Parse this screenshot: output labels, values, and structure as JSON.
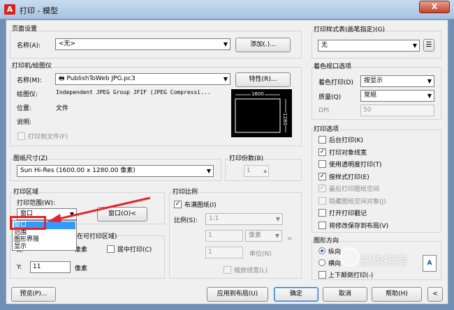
{
  "window": {
    "title": "打印 - 模型",
    "app_icon": "A",
    "close_glyph": "X"
  },
  "page_setup": {
    "group": "页面设置",
    "name_label": "名称(A):",
    "name_value": "<无>",
    "add_button": "添加(.)..."
  },
  "printer": {
    "group": "打印机/绘图仪",
    "name_label": "名称(M):",
    "name_value": "PublishToWeb JPG.pc3",
    "props_button": "特性(R)...",
    "plotter_label": "绘图仪:",
    "plotter_value": "Independent JPEG Group JFIF (JPEG Compressi...",
    "location_label": "位置:",
    "location_value": "文件",
    "desc_label": "说明:",
    "print_to_file": "打印到文件(F)",
    "preview_width": "1600",
    "preview_height": "1280"
  },
  "paper_size": {
    "group": "图纸尺寸(Z)",
    "value": "Sun Hi-Res (1600.00 x 1280.00 像素)"
  },
  "copies": {
    "label": "打印份数(B)",
    "value": "1"
  },
  "area": {
    "group": "打印区域",
    "range_label": "打印范围(W):",
    "range_value": "窗口",
    "window_button": "窗口(O)<",
    "options": [
      "窗口",
      "范围",
      "图形界限",
      "显示"
    ]
  },
  "offset": {
    "group_fragment": "在可打印区域)",
    "x_label": "X:",
    "x_unit": "像素",
    "y_label": "Y:",
    "y_value": "11",
    "y_unit": "像素",
    "center_label": "居中打印(C)"
  },
  "scale": {
    "group": "打印比例",
    "fit_label": "布满图纸(I)",
    "ratio_label": "比例(S):",
    "ratio_value": "1:1",
    "val1": "1",
    "unit1": "像素",
    "val2": "1",
    "unit2": "单位(N)",
    "eq": "=",
    "lineweights": "缩放线宽(L)"
  },
  "plot_style": {
    "group": "打印样式表(画笔指定)(G)",
    "value": "无"
  },
  "shaded": {
    "group": "着色视口选项",
    "shade_label": "着色打印(D)",
    "shade_value": "按显示",
    "quality_label": "质量(Q)",
    "quality_value": "常规",
    "dpi_label": "DPI",
    "dpi_value": "50"
  },
  "options": {
    "group": "打印选项",
    "items": [
      {
        "label": "后台打印(K)",
        "checked": false,
        "disabled": false
      },
      {
        "label": "打印对象线宽",
        "checked": true,
        "disabled": false
      },
      {
        "label": "使用透明度打印(T)",
        "checked": false,
        "disabled": false
      },
      {
        "label": "按样式打印(E)",
        "checked": true,
        "disabled": false
      },
      {
        "label": "最后打印图纸空间",
        "checked": true,
        "disabled": true
      },
      {
        "label": "隐藏图纸空间对象(J)",
        "checked": false,
        "disabled": true
      },
      {
        "label": "打开打印戳记",
        "checked": false,
        "disabled": false
      },
      {
        "label": "将修改保存到布局(V)",
        "checked": false,
        "disabled": false
      }
    ]
  },
  "orientation": {
    "group": "图形方向",
    "portrait": "纵向",
    "landscape": "横向",
    "upside": "上下颠倒打印(-)"
  },
  "footer": {
    "preview": "预览(P)...",
    "apply": "应用到布局(U)",
    "ok": "确定",
    "cancel": "取消",
    "help": "帮助(H)"
  },
  "watermark": "搜狗指南"
}
